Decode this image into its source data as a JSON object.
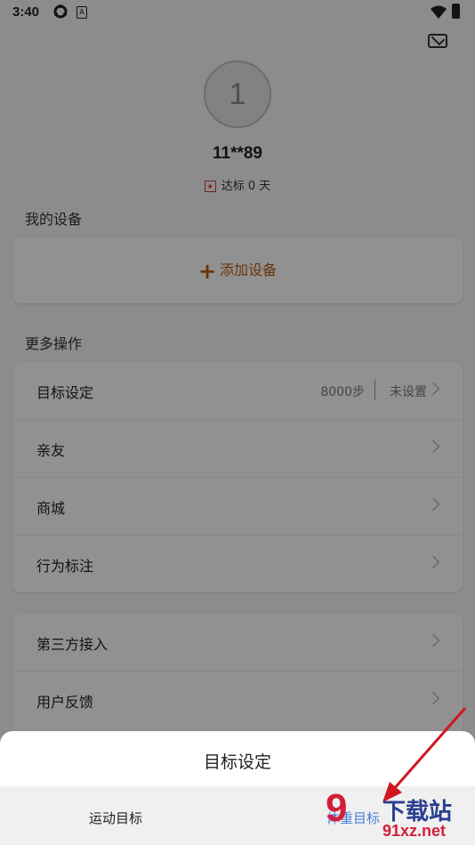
{
  "status_bar": {
    "time": "3:40",
    "app_icon_letter": "A"
  },
  "profile": {
    "avatar_text": "1",
    "username": "11**89",
    "days_label": "达标 0 天"
  },
  "devices": {
    "section_title": "我的设备",
    "add_label": "添加设备"
  },
  "more": {
    "section_title": "更多操作",
    "items": [
      {
        "label": "目标设定",
        "value": "8000步",
        "value2": "未设置"
      },
      {
        "label": "亲友"
      },
      {
        "label": "商城"
      },
      {
        "label": "行为标注"
      }
    ]
  },
  "extra": {
    "items": [
      {
        "label": "第三方接入"
      },
      {
        "label": "用户反馈"
      }
    ]
  },
  "sheet": {
    "title": "目标设定",
    "tabs": [
      "运动目标",
      "体重目标"
    ]
  },
  "watermark": {
    "number": "9",
    "cn": "下载站",
    "url": "91xz.net"
  },
  "colors": {
    "accent": "#b45a10",
    "selected_tab": "#4a7fd8",
    "arrow": "#d0161f"
  }
}
